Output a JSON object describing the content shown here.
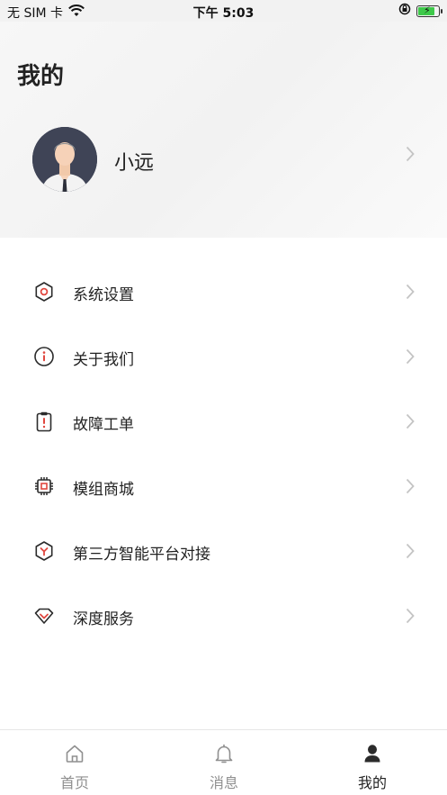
{
  "status_bar": {
    "carrier": "无 SIM 卡",
    "time": "下午 5:03",
    "battery_level": 0.85
  },
  "header": {
    "title": "我的",
    "username": "小远"
  },
  "menu": {
    "items": [
      {
        "label": "系统设置",
        "icon": "hexagon-settings-icon"
      },
      {
        "label": "关于我们",
        "icon": "info-icon"
      },
      {
        "label": "故障工单",
        "icon": "clipboard-alert-icon"
      },
      {
        "label": "模组商城",
        "icon": "chip-icon"
      },
      {
        "label": "第三方智能平台对接",
        "icon": "hexagon-link-icon"
      },
      {
        "label": "深度服务",
        "icon": "diamond-icon"
      }
    ]
  },
  "tab_bar": {
    "tabs": [
      {
        "label": "首页",
        "icon": "home-icon"
      },
      {
        "label": "消息",
        "icon": "bell-icon"
      },
      {
        "label": "我的",
        "icon": "person-icon"
      }
    ],
    "active_index": 2
  },
  "colors": {
    "accent_red": "#e0473f",
    "icon_dark": "#2b2b2b",
    "inactive_gray": "#8f8f8f",
    "chevron_gray": "#c4c4c4"
  }
}
